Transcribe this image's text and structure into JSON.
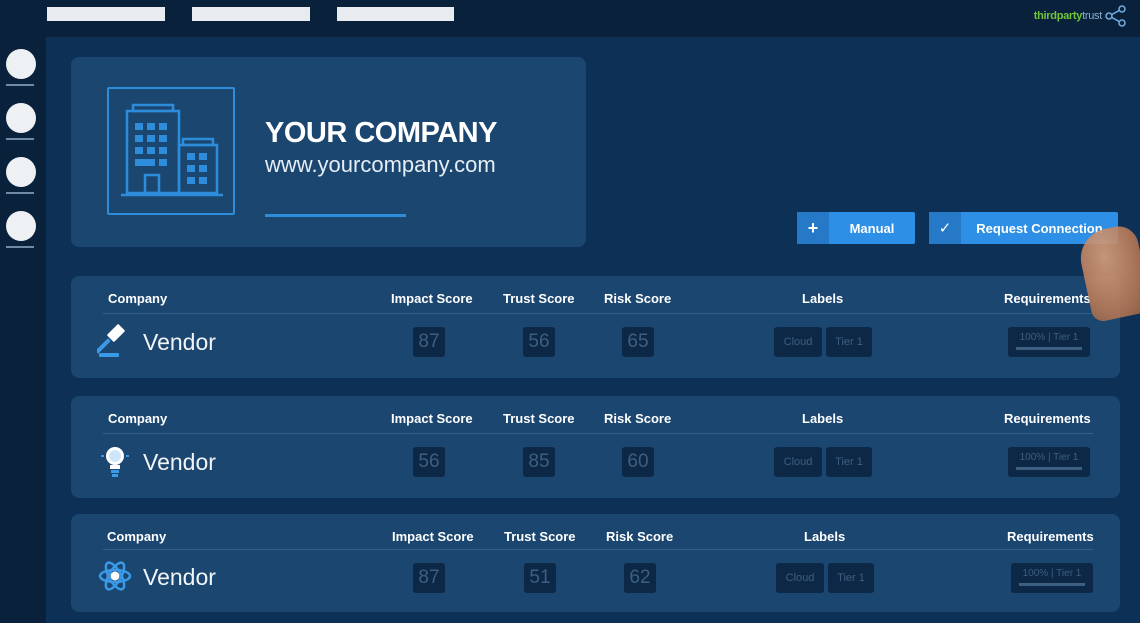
{
  "brand": {
    "logo_main": "thirdparty",
    "logo_accent": "trust"
  },
  "company": {
    "name": "YOUR COMPANY",
    "url": "www.yourcompany.com"
  },
  "actions": {
    "manual_glyph": "+",
    "manual_label": "Manual",
    "request_glyph": "✓",
    "request_label": "Request Connection"
  },
  "headers": {
    "company": "Company",
    "impact": "Impact Score",
    "trust": "Trust Score",
    "risk": "Risk Score",
    "labels": "Labels",
    "requirements": "Requirements"
  },
  "vendors": [
    {
      "name": "Vendor",
      "icon": "gavel-icon",
      "impact": "87",
      "trust": "56",
      "risk": "65",
      "label1": "Cloud",
      "label2": "Tier 1",
      "requirement": "100% | Tier 1"
    },
    {
      "name": "Vendor",
      "icon": "lightbulb-icon",
      "impact": "56",
      "trust": "85",
      "risk": "60",
      "label1": "Cloud",
      "label2": "Tier 1",
      "requirement": "100% | Tier 1"
    },
    {
      "name": "Vendor",
      "icon": "atom-icon",
      "impact": "87",
      "trust": "51",
      "risk": "62",
      "label1": "Cloud",
      "label2": "Tier 1",
      "requirement": "100% | Tier 1"
    }
  ],
  "colors": {
    "accent": "#2d8fe5",
    "background": "#0d3156",
    "card": "#1a4670",
    "logo_green": "#6fc43a"
  }
}
